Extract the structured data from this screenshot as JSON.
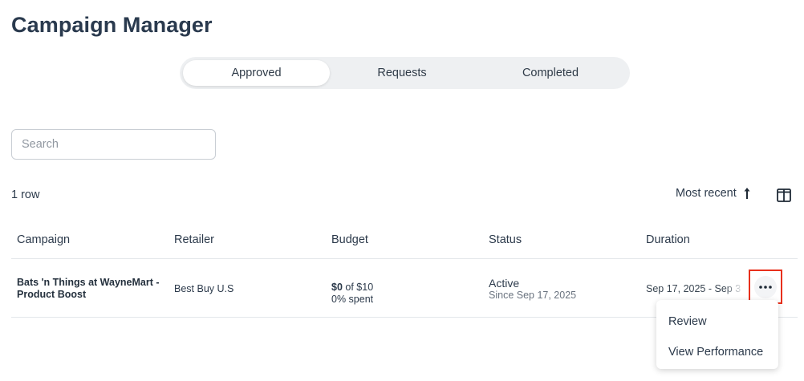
{
  "page": {
    "title": "Campaign Manager"
  },
  "tabs": [
    {
      "label": "Approved",
      "active": true
    },
    {
      "label": "Requests",
      "active": false
    },
    {
      "label": "Completed",
      "active": false
    }
  ],
  "search": {
    "placeholder": "Search",
    "value": ""
  },
  "table_meta": {
    "row_count": "1 row",
    "sort_label": "Most recent",
    "sort_icon": "arrow-up-icon",
    "columns_icon": "columns-icon"
  },
  "table": {
    "headers": [
      "Campaign",
      "Retailer",
      "Budget",
      "Status",
      "Duration"
    ],
    "rows": [
      {
        "campaign": "Bats 'n Things at WayneMart - Product Boost",
        "retailer": "Best Buy U.S",
        "budget_spent": "$0",
        "budget_of": "of $10",
        "budget_percent": "0% spent",
        "status": "Active",
        "status_since": "Since Sep 17, 2025",
        "duration": "Sep 17, 2025 - Sep 3",
        "actions_icon": "more-horizontal-icon"
      }
    ]
  },
  "row_menu": {
    "items": [
      "Review",
      "View Performance"
    ]
  },
  "colors": {
    "highlight_border": "#e8301c",
    "tab_track": "#eef0f2",
    "text_primary": "#2c3a4b"
  }
}
